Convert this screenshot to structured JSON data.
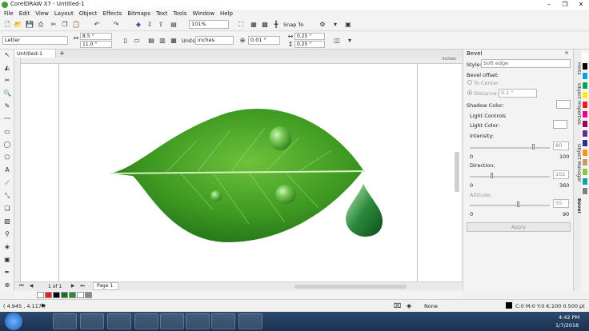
{
  "window": {
    "title": "CorelDRAW X7 - Untitled-1"
  },
  "menu": [
    "File",
    "Edit",
    "View",
    "Layout",
    "Object",
    "Effects",
    "Bitmaps",
    "Text",
    "Tools",
    "Window",
    "Help"
  ],
  "toolbar": {
    "zoom": "101%",
    "snap_to": "Snap To"
  },
  "property_bar": {
    "paper": "Letter",
    "width": "8.5 \"",
    "height": "11.0 \"",
    "units_label": "Units:",
    "units": "inches",
    "nudge": "0.01 \"",
    "dup_x": "0.25 \"",
    "dup_y": "0.25 \""
  },
  "document": {
    "tab": "Untitled-1",
    "ruler_unit": "inches"
  },
  "page_nav": {
    "page_count": "1 of 1",
    "page_tab": "Page 1"
  },
  "docker": {
    "title": "Bevel",
    "style_label": "Style:",
    "style_value": "Soft edge",
    "bevel_offset_label": "Bevel offset:",
    "to_center": "To Center",
    "distance_label": "Distance:",
    "distance_value": "0.1 \"",
    "shadow_color_label": "Shadow Color:",
    "light_controls_label": "Light Controls",
    "light_color_label": "Light Color:",
    "intensity_label": "Intensity:",
    "intensity_value": "80",
    "intensity_min": "0",
    "intensity_max": "100",
    "direction_label": "Direction:",
    "direction_value": "102",
    "direction_min": "0",
    "direction_max": "360",
    "altitude_label": "Altitude:",
    "altitude_value": "55",
    "altitude_min": "0",
    "altitude_max": "90",
    "apply": "Apply",
    "intensity_level": 0.8,
    "direction_level": 0.283,
    "altitude_level": 0.611
  },
  "side_tabs": [
    "Hints",
    "Object Properties",
    "Object Manager",
    "Bevel"
  ],
  "palette_colors": [
    "#ffffff",
    "#000000",
    "#00a0e3",
    "#00a651",
    "#f7ec13",
    "#ec1c24",
    "#ed008c",
    "#9e005d",
    "#662d91",
    "#2e3192",
    "#f7941d",
    "#c69c6d",
    "#8dc63f",
    "#00a99d",
    "#7f7f7f"
  ],
  "doc_palette_colors": [
    "#ffffff",
    "#ec1c24",
    "#000000",
    "#1a6e2c",
    "#2d8a3a",
    "#ffffff",
    "#8a8a8a"
  ],
  "status": {
    "coords": "( 4.945 , 4.117 )",
    "fill": "None",
    "outline": "C:0 M:0 Y:0 K:100  0.500 pt"
  },
  "taskbar": {
    "time": "4:42 PM",
    "date": "1/7/2018"
  }
}
